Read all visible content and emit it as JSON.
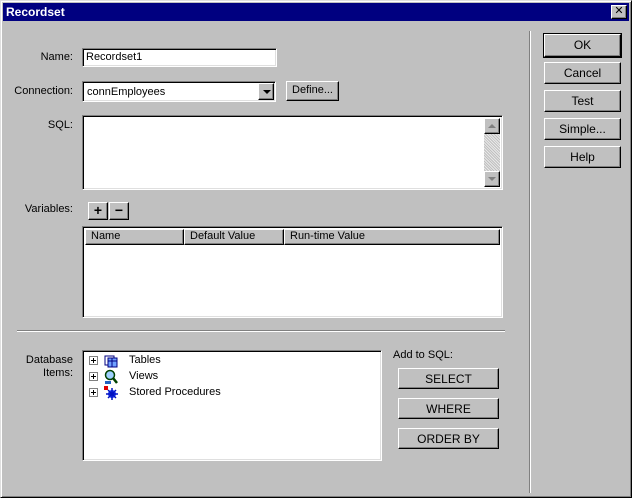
{
  "window": {
    "title": "Recordset"
  },
  "form": {
    "name_label": "Name:",
    "name_value": "Recordset1",
    "connection_label": "Connection:",
    "connection_value": "connEmployees",
    "define_label": "Define...",
    "sql_label": "SQL:",
    "sql_value": "",
    "variables_label": "Variables:",
    "add_variable": "+",
    "remove_variable": "−"
  },
  "variables_table": {
    "columns": [
      "Name",
      "Default Value",
      "Run-time Value"
    ],
    "rows": []
  },
  "database_items": {
    "label": "Database Items:",
    "items": [
      {
        "label": "Tables",
        "icon": "tables-icon"
      },
      {
        "label": "Views",
        "icon": "views-icon"
      },
      {
        "label": "Stored Procedures",
        "icon": "stored-procedures-icon"
      }
    ]
  },
  "add_to_sql": {
    "label": "Add to SQL:",
    "buttons": [
      "SELECT",
      "WHERE",
      "ORDER BY"
    ]
  },
  "side_buttons": [
    "OK",
    "Cancel",
    "Test",
    "Simple...",
    "Help"
  ]
}
